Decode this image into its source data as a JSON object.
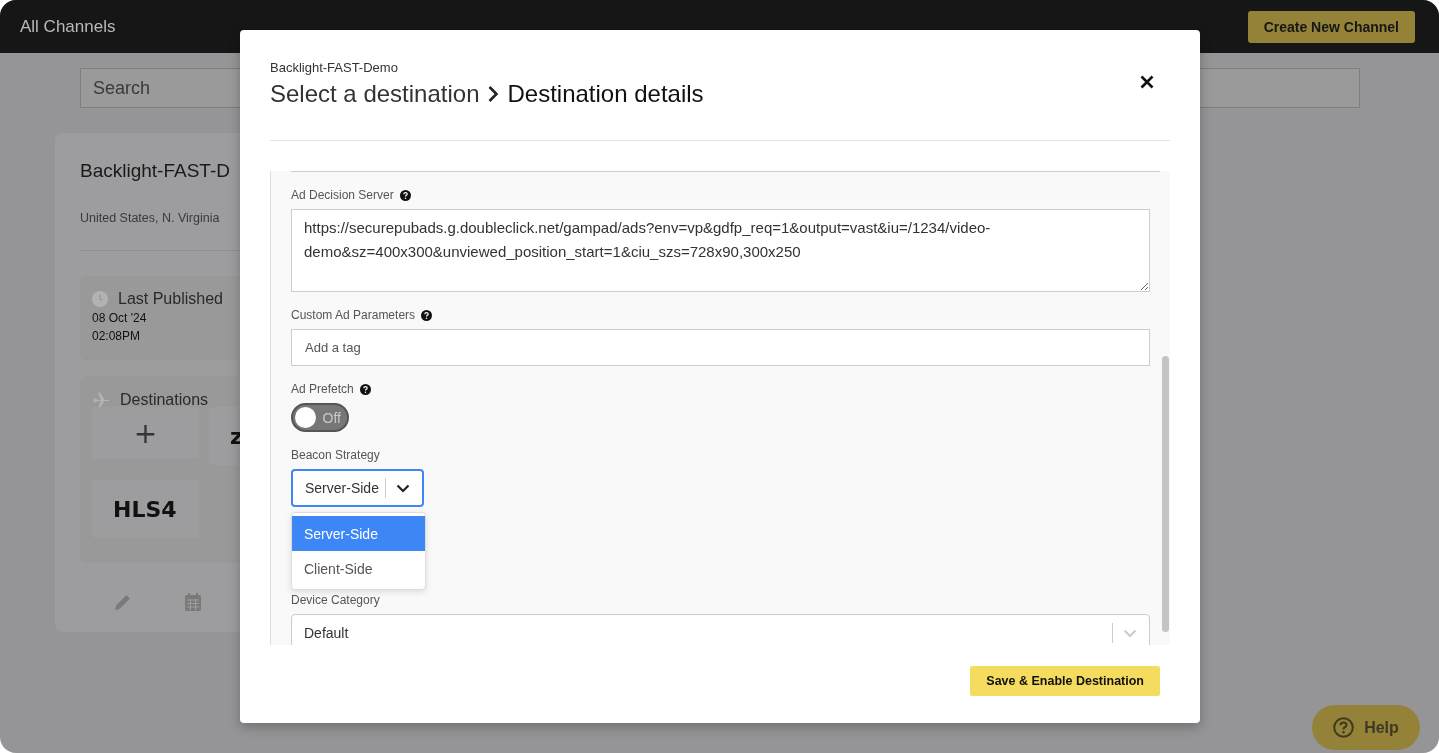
{
  "header": {
    "title": "All Channels",
    "create_button": "Create New Channel"
  },
  "search": {
    "placeholder": "Search"
  },
  "channel_card": {
    "title": "Backlight-FAST-D",
    "region": "United States, N. Virginia",
    "last_published": {
      "label": "Last Published",
      "date": "08 Oct '24",
      "time": "02:08PM"
    },
    "destinations": {
      "label": "Destinations",
      "tiles": [
        {
          "kind": "add",
          "text": "+"
        },
        {
          "kind": "name",
          "text": "z"
        },
        {
          "kind": "name",
          "text": "HLS4"
        }
      ]
    }
  },
  "help_button": {
    "label": "Help"
  },
  "modal": {
    "breadcrumb": "Backlight-FAST-Demo",
    "title_step_1": "Select a destination",
    "title_step_2": "Destination details",
    "fields": [
      {
        "kind": "textarea",
        "label": "Ad Decision Server",
        "help": true,
        "value": "https://securepubads.g.doubleclick.net/gampad/ads?env=vp&gdfp_req=1&output=vast&iu=/1234/video-demo&sz=400x300&unviewed_position_start=1&ciu_szs=728x90,300x250"
      },
      {
        "kind": "tags",
        "label": "Custom Ad Parameters",
        "help": true,
        "placeholder": "Add a tag"
      },
      {
        "kind": "toggle",
        "label": "Ad Prefetch",
        "help": true,
        "on": false,
        "state_text": "Off"
      },
      {
        "kind": "select",
        "label": "Beacon Strategy",
        "help": false,
        "value": "Server-Side",
        "focused": true,
        "expanded": true,
        "options": [
          {
            "label": "Server-Side",
            "selected": true
          },
          {
            "label": "Client-Side",
            "selected": false
          }
        ]
      },
      {
        "kind": "select",
        "label": "Device Category",
        "help": false,
        "value": "Default",
        "focused": false
      }
    ],
    "save_button": "Save & Enable Destination"
  }
}
